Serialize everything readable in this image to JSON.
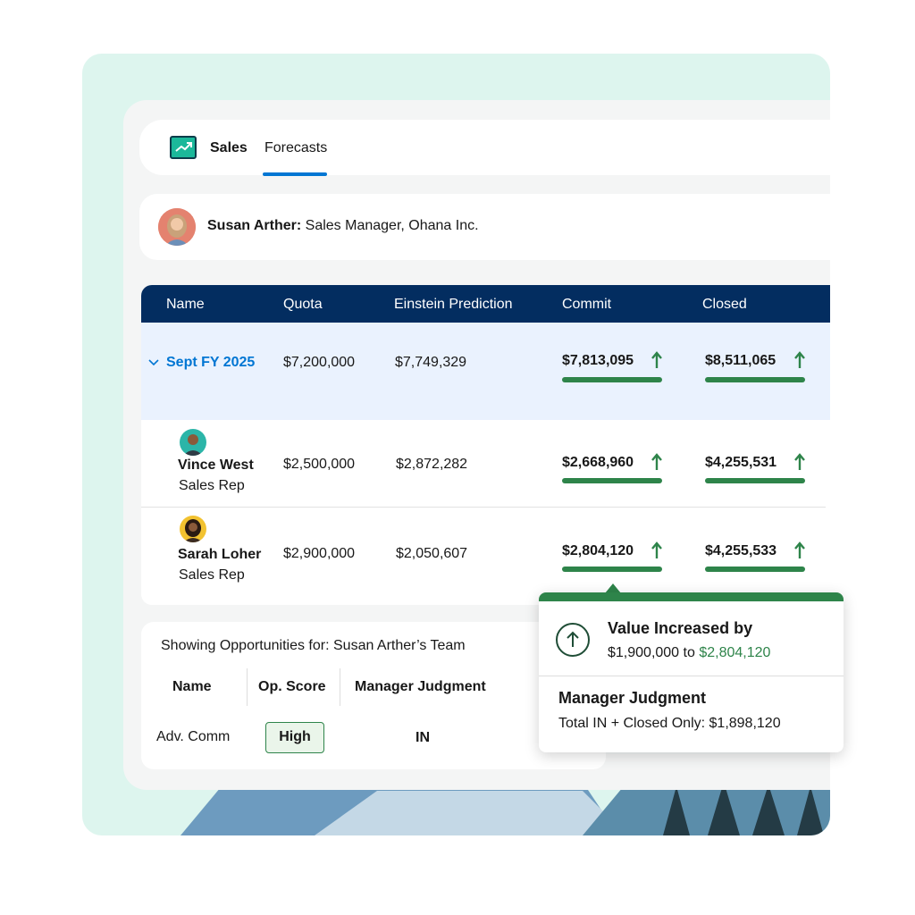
{
  "app": {
    "name": "Sales",
    "tab": "Forecasts"
  },
  "user": {
    "name": "Susan Arther:",
    "role": "Sales Manager, Ohana Inc."
  },
  "table": {
    "columns": [
      "Name",
      "Quota",
      "Einstein Prediction",
      "Commit",
      "Closed"
    ],
    "period": {
      "label": "Sept FY 2025",
      "quota": "$7,200,000",
      "prediction": "$7,749,329",
      "commit": "$7,813,095",
      "closed": "$8,511,065"
    },
    "reps": [
      {
        "name": "Vince West",
        "title": "Sales Rep",
        "quota": "$2,500,000",
        "prediction": "$2,872,282",
        "commit": "$2,668,960",
        "closed": "$4,255,531"
      },
      {
        "name": "Sarah Loher",
        "title": "Sales Rep",
        "quota": "$2,900,000",
        "prediction": "$2,050,607",
        "commit": "$2,804,120",
        "closed": "$4,255,533"
      }
    ]
  },
  "opportunities": {
    "title": "Showing Opportunities for: Susan Arther’s Team",
    "columns": [
      "Name",
      "Op. Score",
      "Manager Judgment"
    ],
    "row": {
      "name": "Adv. Comm",
      "score": "High",
      "judgment": "IN"
    }
  },
  "popover": {
    "heading": "Value Increased by",
    "from": "$1,900,000",
    "to_word": "to",
    "to": "$2,804,120",
    "section_title": "Manager Judgment",
    "section_text": "Total IN + Closed Only: $1,898,120"
  },
  "colors": {
    "navy": "#032d60",
    "accent_blue": "#0176d3",
    "green": "#2e844a",
    "mint": "#ddf5ee"
  },
  "icons": [
    "sales-app-icon",
    "chevron-down-icon",
    "up-arrow-icon",
    "arrow-up-circle-icon"
  ]
}
